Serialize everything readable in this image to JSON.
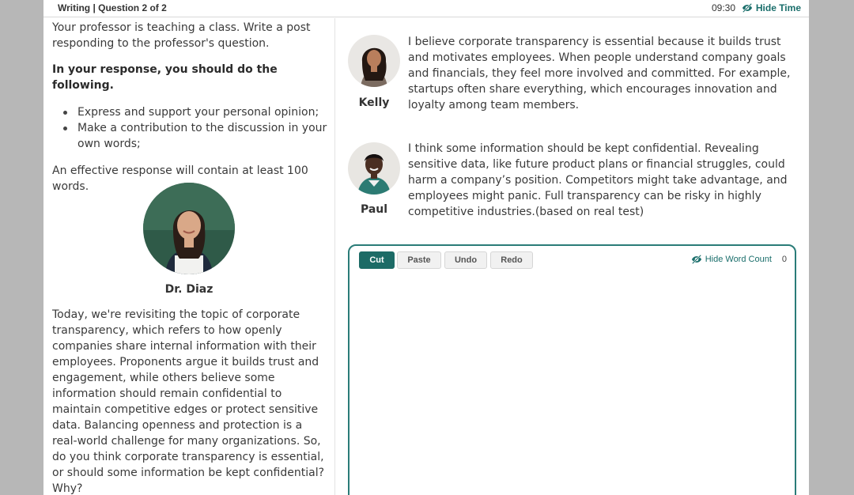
{
  "header": {
    "title": "Writing | Question 2 of 2",
    "timer": "09:30",
    "hide_time_label": "Hide Time"
  },
  "prompt": {
    "intro": "Your professor is teaching a class. Write a post responding to the professor's question.",
    "requirements_heading": "In your response, you should do the following.",
    "bullets": [
      "Express and support your personal opinion;",
      "Make a contribution to the discussion in your own words;"
    ],
    "effective": "An effective response will contain at least 100 words.",
    "professor_name": "Dr. Diaz",
    "professor_text": "Today, we're revisiting the topic of corporate transparency, which refers to how openly companies share internal information with their employees. Proponents argue it builds trust and engagement, while others believe some information should remain confidential to maintain competitive edges or protect sensitive data. Balancing openness and protection is a real-world challenge for many organizations. So, do you think corporate transparency is essential, or should some information be kept confidential? Why?"
  },
  "posts": [
    {
      "name": "Kelly",
      "text": "I believe corporate transparency is essential because it builds trust and motivates employees. When people understand company goals and financials, they feel more involved and committed. For example, startups often share everything, which encourages innovation and loyalty among team members."
    },
    {
      "name": "Paul",
      "text": "I think some information should be kept confidential. Revealing sensitive data, like future product plans or financial struggles, could harm a company’s position. Competitors might take advantage, and employees might panic. Full transparency can be risky in highly competitive industries.(based on real test)"
    }
  ],
  "editor": {
    "buttons": [
      "Cut",
      "Paste",
      "Undo",
      "Redo"
    ],
    "hide_word_count_label": "Hide Word Count",
    "word_count": "0",
    "value": ""
  },
  "colors": {
    "accent": "#1c6b66",
    "border": "#2a7c78",
    "background": "#b7b7b7"
  },
  "icons": {
    "hide_time": "eye-slash-icon",
    "hide_word_count": "eye-slash-icon"
  }
}
